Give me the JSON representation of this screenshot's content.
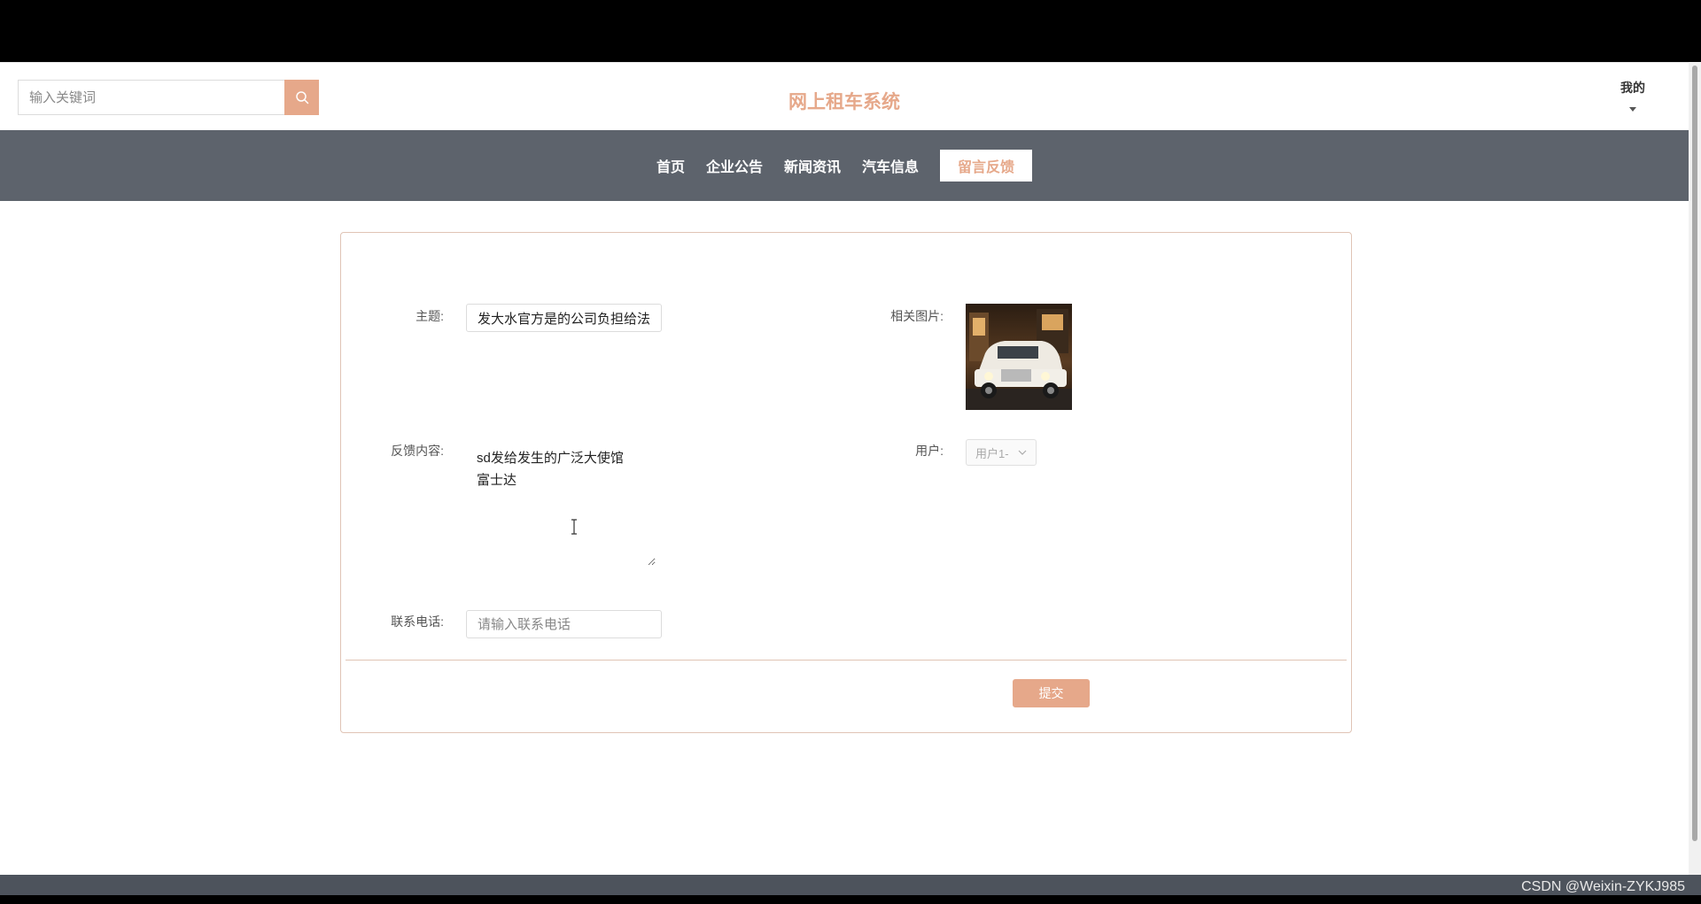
{
  "header": {
    "search_placeholder": "输入关键词",
    "site_title": "网上租车系统",
    "user_menu_label": "我的"
  },
  "nav": {
    "items": [
      {
        "label": "首页"
      },
      {
        "label": "企业公告"
      },
      {
        "label": "新闻资讯"
      },
      {
        "label": "汽车信息"
      },
      {
        "label": "留言反馈"
      }
    ],
    "active_index": 4
  },
  "form": {
    "subject_label": "主题:",
    "subject_value": "发大水官方是的公司负担给法",
    "image_label": "相关图片:",
    "content_label": "反馈内容:",
    "content_value": "sd发给发生的广泛大使馆\n富士达",
    "user_label": "用户:",
    "user_value": "用户1-",
    "phone_label": "联系电话:",
    "phone_placeholder": "请输入联系电话",
    "submit_label": "提交"
  },
  "watermark": "CSDN @Weixin-ZYKJ985",
  "colors": {
    "accent": "#e6a88a",
    "nav_bg": "#5d636c",
    "footer_bg": "#4d535c"
  }
}
